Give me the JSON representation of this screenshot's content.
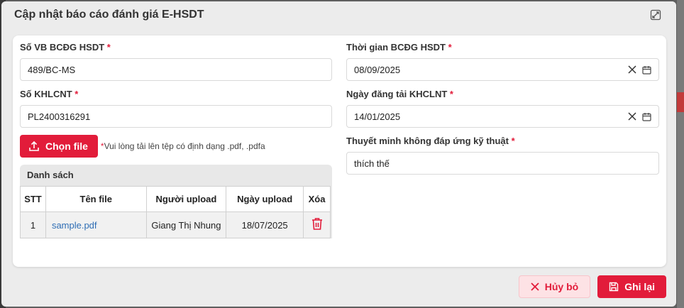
{
  "modal": {
    "title": "Cập nhật báo cáo đánh giá E-HSDT"
  },
  "form": {
    "so_vb": {
      "label": "Số VB BCĐG HSDT",
      "required": "*",
      "value": "489/BC-MS"
    },
    "so_khlcnt": {
      "label": "Số KHLCNT",
      "required": "*",
      "value": "PL2400316291"
    },
    "thoi_gian": {
      "label": "Thời gian BCĐG HSDT",
      "required": "*",
      "value": "08/09/2025"
    },
    "ngay_dang_tai": {
      "label": "Ngày đăng tải KHCLNT",
      "required": "*",
      "value": "14/01/2025"
    },
    "thuyet_minh": {
      "label": "Thuyết minh không đáp ứng kỹ thuật",
      "required": "*",
      "value": "thích thế"
    }
  },
  "upload": {
    "button_label": "Chọn file",
    "hint_star": "*",
    "hint": "Vui lòng tải lên tệp có định dạng .pdf, .pdfa"
  },
  "file_list": {
    "title": "Danh sách",
    "headers": [
      "STT",
      "Tên file",
      "Người upload",
      "Ngày upload",
      "Xóa"
    ],
    "rows": [
      {
        "stt": "1",
        "name": "sample.pdf",
        "uploader": "Giang Thị Nhung",
        "date": "18/07/2025"
      }
    ]
  },
  "footer": {
    "cancel_label": "Hủy bỏ",
    "save_label": "Ghi lại"
  },
  "colors": {
    "accent": "#e21c3a",
    "link": "#2f6eb5"
  },
  "icons": {
    "expand": "expand-icon",
    "clear": "close-icon",
    "calendar": "calendar-icon",
    "upload": "upload-icon",
    "delete": "trash-icon",
    "cancel": "close-icon",
    "save": "save-icon"
  }
}
